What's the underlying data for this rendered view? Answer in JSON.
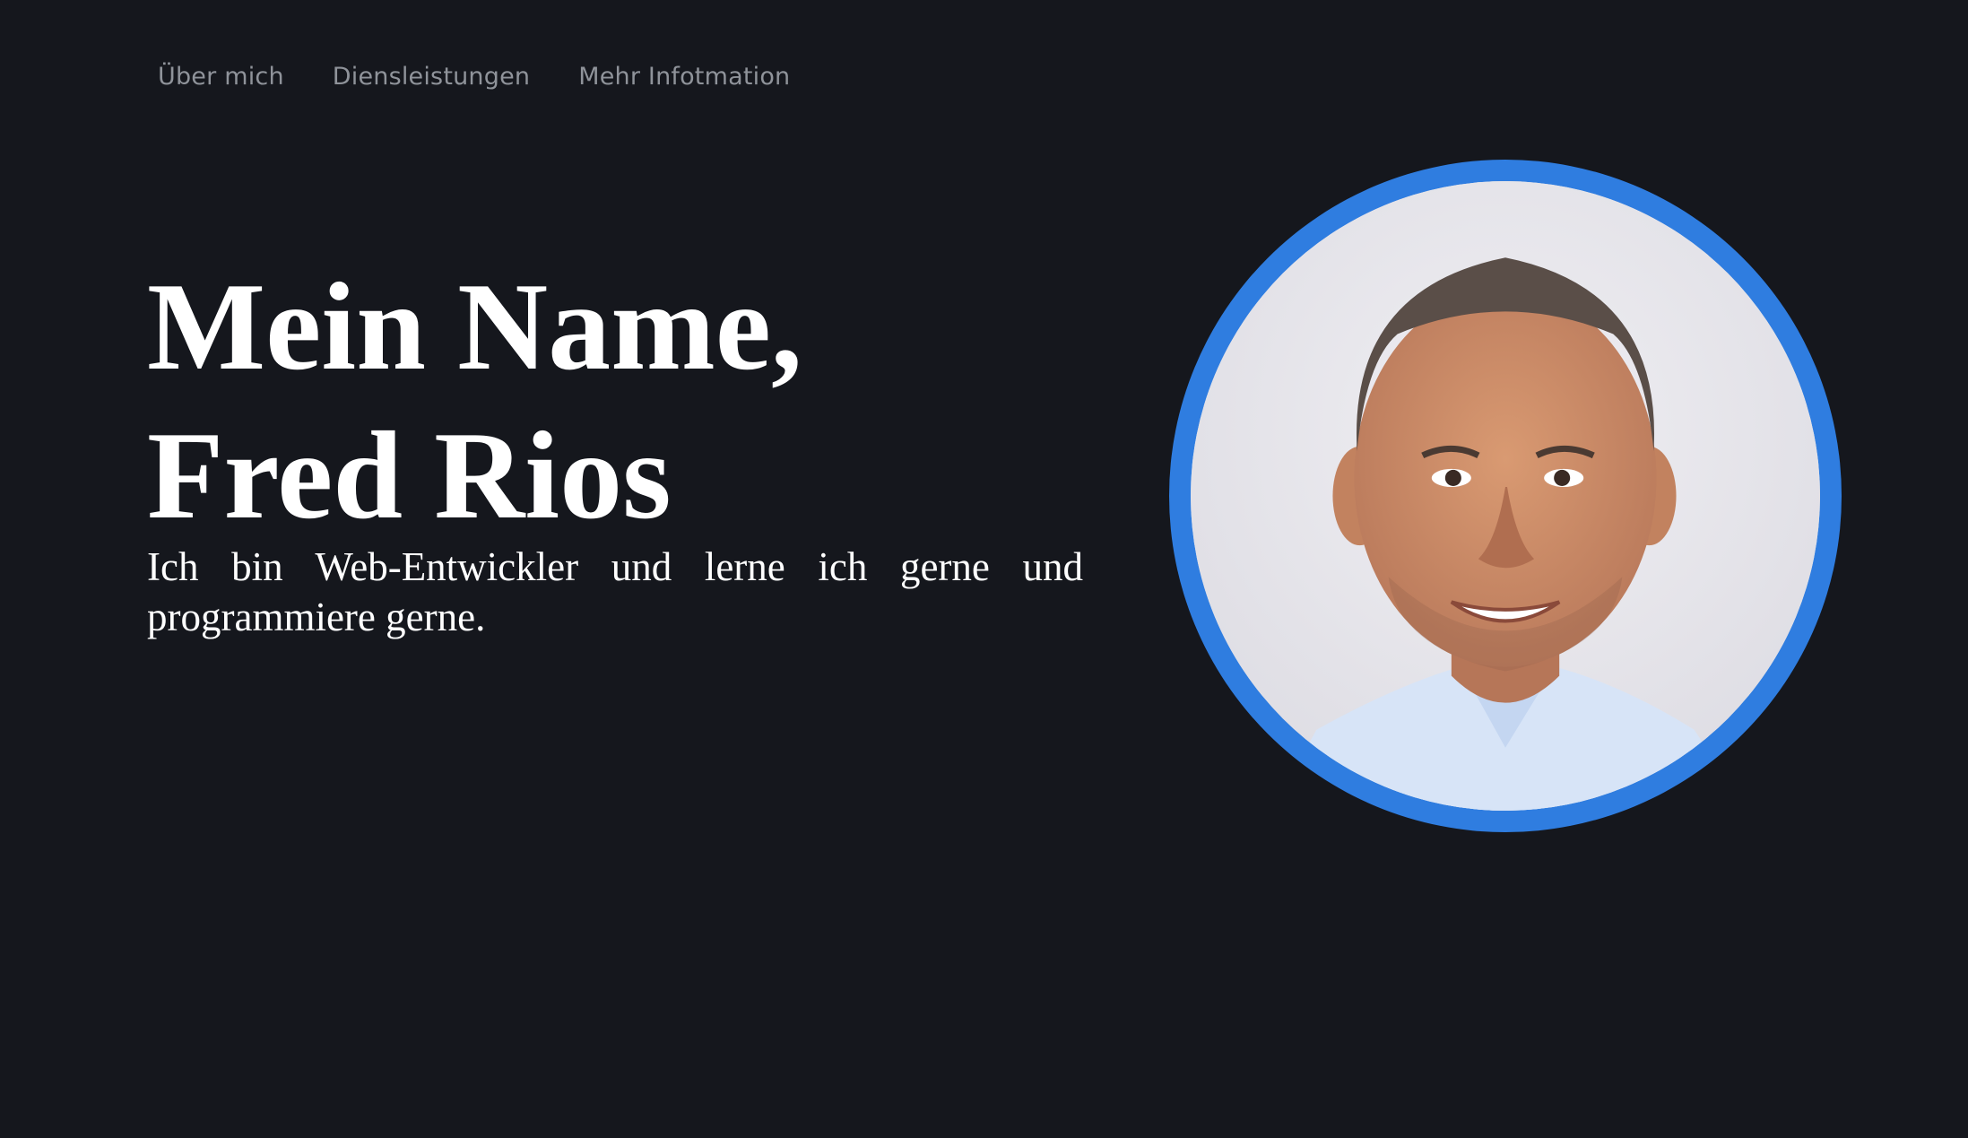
{
  "nav": {
    "items": [
      {
        "label": "Über mich"
      },
      {
        "label": "Diensleistungen"
      },
      {
        "label": "Mehr Infotmation"
      }
    ]
  },
  "hero": {
    "title_line1": "Mein Name,",
    "title_line2": "Fred Rios",
    "description": "Ich bin Web-Entwickler und lerne ich gerne und programmiere gerne."
  },
  "colors": {
    "background": "#15171d",
    "nav_text": "#8f939a",
    "heading_text": "#ffffff",
    "avatar_ring": "#2f7de0"
  },
  "profile_image": {
    "icon": "person-portrait"
  }
}
